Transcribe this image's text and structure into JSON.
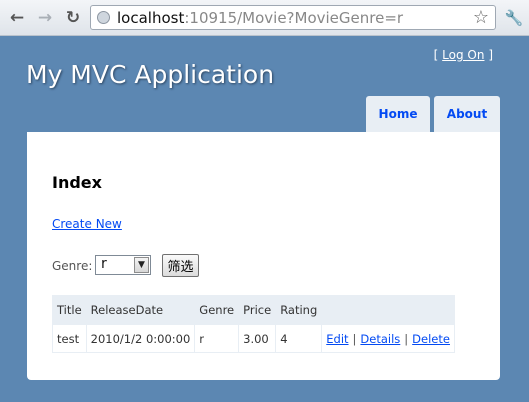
{
  "browser": {
    "url_host": "localhost",
    "url_rest": ":10915/Movie?MovieGenre=r"
  },
  "header": {
    "login_prefix": "[",
    "login_link": "Log On",
    "login_suffix": "]",
    "title": "My MVC Application",
    "tabs": [
      {
        "label": "Home"
      },
      {
        "label": "About"
      }
    ]
  },
  "main": {
    "heading": "Index",
    "create_link": "Create New",
    "filter": {
      "label": "Genre:",
      "selected": "r",
      "button": "筛选"
    },
    "table": {
      "columns": [
        "Title",
        "ReleaseDate",
        "Genre",
        "Price",
        "Rating",
        ""
      ],
      "rows": [
        {
          "title": "test",
          "release_date": "2010/1/2 0:00:00",
          "genre": "r",
          "price": "3.00",
          "rating": "4",
          "actions": [
            "Edit",
            "Details",
            "Delete"
          ],
          "separator": "|"
        }
      ]
    }
  },
  "colors": {
    "page_background": "#5c87b2",
    "link": "#034af3",
    "tab_background": "#e8eef4"
  }
}
